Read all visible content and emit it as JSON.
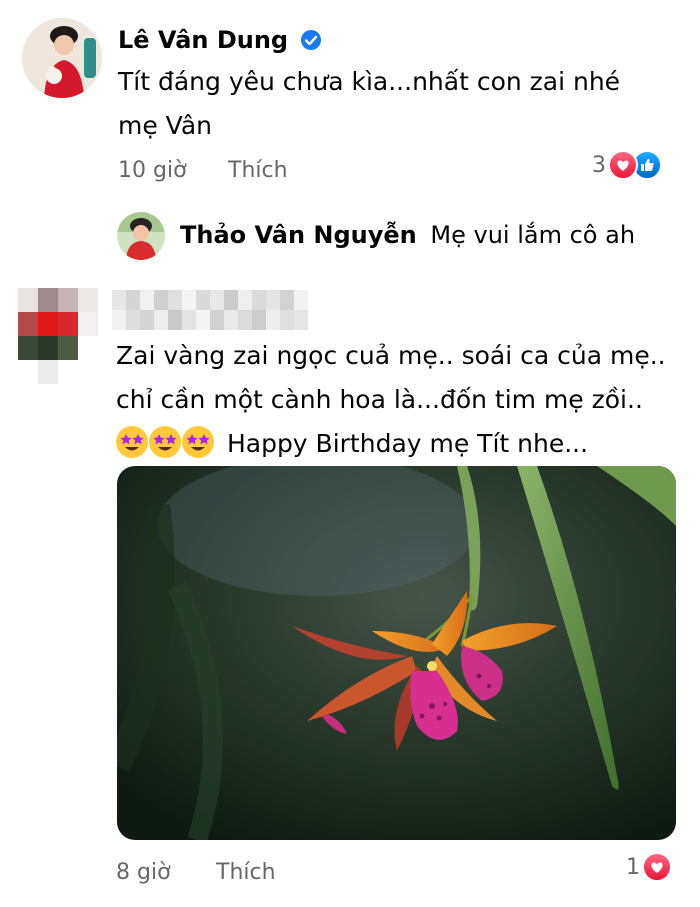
{
  "comment1": {
    "author": "Lê Vân Dung",
    "text_line1": "Tít đáng yêu chưa kìa...nhất con zai nhé",
    "text_line2": "mẹ Vân",
    "time": "10 giờ",
    "like_action": "Thích",
    "reaction_count": "3",
    "verified_icon": "verified-badge-icon",
    "colors": {
      "verified": "#1877f2",
      "love": "#f02849",
      "like": "#1877f2"
    }
  },
  "reply1": {
    "author": "Thảo Vân Nguyễn",
    "text": "Mẹ vui lắm cô ah"
  },
  "comment2": {
    "author_redacted": true,
    "text_line1": "Zai vàng zai ngọc cuả mẹ.. soái ca của mẹ..",
    "text_line2": "chỉ cần một cành hoa là...đốn tim mẹ zồi..",
    "text_line3": "Happy Birthday mẹ Tít nhe...",
    "emoji": [
      "star-struck-icon",
      "star-struck-icon",
      "star-struck-icon"
    ],
    "photo": "orchid-flower-photo",
    "time": "8 giờ",
    "like_action": "Thích",
    "reaction_count": "1"
  }
}
